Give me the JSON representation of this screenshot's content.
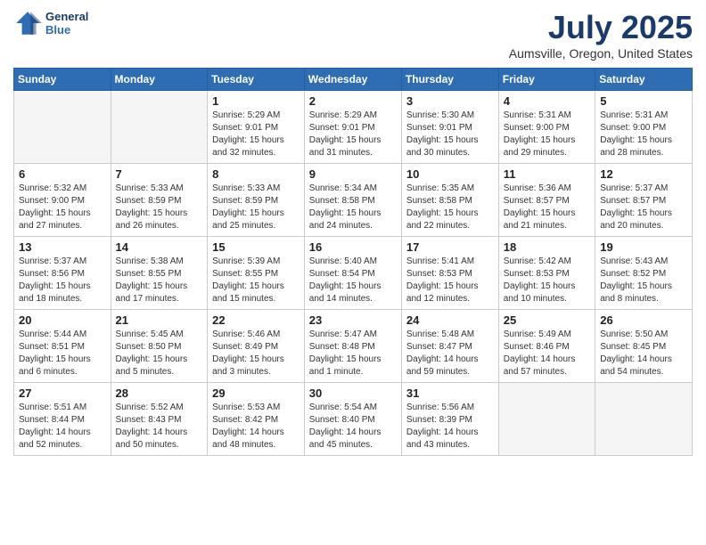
{
  "header": {
    "logo_line1": "General",
    "logo_line2": "Blue",
    "title": "July 2025",
    "subtitle": "Aumsville, Oregon, United States"
  },
  "days_of_week": [
    "Sunday",
    "Monday",
    "Tuesday",
    "Wednesday",
    "Thursday",
    "Friday",
    "Saturday"
  ],
  "weeks": [
    [
      {
        "day": "",
        "info": ""
      },
      {
        "day": "",
        "info": ""
      },
      {
        "day": "1",
        "info": "Sunrise: 5:29 AM\nSunset: 9:01 PM\nDaylight: 15 hours\nand 32 minutes."
      },
      {
        "day": "2",
        "info": "Sunrise: 5:29 AM\nSunset: 9:01 PM\nDaylight: 15 hours\nand 31 minutes."
      },
      {
        "day": "3",
        "info": "Sunrise: 5:30 AM\nSunset: 9:01 PM\nDaylight: 15 hours\nand 30 minutes."
      },
      {
        "day": "4",
        "info": "Sunrise: 5:31 AM\nSunset: 9:00 PM\nDaylight: 15 hours\nand 29 minutes."
      },
      {
        "day": "5",
        "info": "Sunrise: 5:31 AM\nSunset: 9:00 PM\nDaylight: 15 hours\nand 28 minutes."
      }
    ],
    [
      {
        "day": "6",
        "info": "Sunrise: 5:32 AM\nSunset: 9:00 PM\nDaylight: 15 hours\nand 27 minutes."
      },
      {
        "day": "7",
        "info": "Sunrise: 5:33 AM\nSunset: 8:59 PM\nDaylight: 15 hours\nand 26 minutes."
      },
      {
        "day": "8",
        "info": "Sunrise: 5:33 AM\nSunset: 8:59 PM\nDaylight: 15 hours\nand 25 minutes."
      },
      {
        "day": "9",
        "info": "Sunrise: 5:34 AM\nSunset: 8:58 PM\nDaylight: 15 hours\nand 24 minutes."
      },
      {
        "day": "10",
        "info": "Sunrise: 5:35 AM\nSunset: 8:58 PM\nDaylight: 15 hours\nand 22 minutes."
      },
      {
        "day": "11",
        "info": "Sunrise: 5:36 AM\nSunset: 8:57 PM\nDaylight: 15 hours\nand 21 minutes."
      },
      {
        "day": "12",
        "info": "Sunrise: 5:37 AM\nSunset: 8:57 PM\nDaylight: 15 hours\nand 20 minutes."
      }
    ],
    [
      {
        "day": "13",
        "info": "Sunrise: 5:37 AM\nSunset: 8:56 PM\nDaylight: 15 hours\nand 18 minutes."
      },
      {
        "day": "14",
        "info": "Sunrise: 5:38 AM\nSunset: 8:55 PM\nDaylight: 15 hours\nand 17 minutes."
      },
      {
        "day": "15",
        "info": "Sunrise: 5:39 AM\nSunset: 8:55 PM\nDaylight: 15 hours\nand 15 minutes."
      },
      {
        "day": "16",
        "info": "Sunrise: 5:40 AM\nSunset: 8:54 PM\nDaylight: 15 hours\nand 14 minutes."
      },
      {
        "day": "17",
        "info": "Sunrise: 5:41 AM\nSunset: 8:53 PM\nDaylight: 15 hours\nand 12 minutes."
      },
      {
        "day": "18",
        "info": "Sunrise: 5:42 AM\nSunset: 8:53 PM\nDaylight: 15 hours\nand 10 minutes."
      },
      {
        "day": "19",
        "info": "Sunrise: 5:43 AM\nSunset: 8:52 PM\nDaylight: 15 hours\nand 8 minutes."
      }
    ],
    [
      {
        "day": "20",
        "info": "Sunrise: 5:44 AM\nSunset: 8:51 PM\nDaylight: 15 hours\nand 6 minutes."
      },
      {
        "day": "21",
        "info": "Sunrise: 5:45 AM\nSunset: 8:50 PM\nDaylight: 15 hours\nand 5 minutes."
      },
      {
        "day": "22",
        "info": "Sunrise: 5:46 AM\nSunset: 8:49 PM\nDaylight: 15 hours\nand 3 minutes."
      },
      {
        "day": "23",
        "info": "Sunrise: 5:47 AM\nSunset: 8:48 PM\nDaylight: 15 hours\nand 1 minute."
      },
      {
        "day": "24",
        "info": "Sunrise: 5:48 AM\nSunset: 8:47 PM\nDaylight: 14 hours\nand 59 minutes."
      },
      {
        "day": "25",
        "info": "Sunrise: 5:49 AM\nSunset: 8:46 PM\nDaylight: 14 hours\nand 57 minutes."
      },
      {
        "day": "26",
        "info": "Sunrise: 5:50 AM\nSunset: 8:45 PM\nDaylight: 14 hours\nand 54 minutes."
      }
    ],
    [
      {
        "day": "27",
        "info": "Sunrise: 5:51 AM\nSunset: 8:44 PM\nDaylight: 14 hours\nand 52 minutes."
      },
      {
        "day": "28",
        "info": "Sunrise: 5:52 AM\nSunset: 8:43 PM\nDaylight: 14 hours\nand 50 minutes."
      },
      {
        "day": "29",
        "info": "Sunrise: 5:53 AM\nSunset: 8:42 PM\nDaylight: 14 hours\nand 48 minutes."
      },
      {
        "day": "30",
        "info": "Sunrise: 5:54 AM\nSunset: 8:40 PM\nDaylight: 14 hours\nand 45 minutes."
      },
      {
        "day": "31",
        "info": "Sunrise: 5:56 AM\nSunset: 8:39 PM\nDaylight: 14 hours\nand 43 minutes."
      },
      {
        "day": "",
        "info": ""
      },
      {
        "day": "",
        "info": ""
      }
    ]
  ]
}
